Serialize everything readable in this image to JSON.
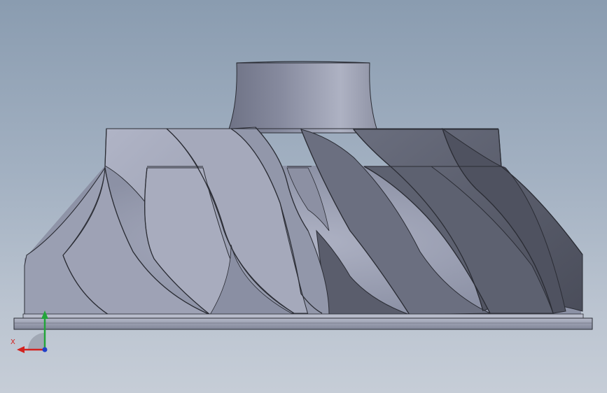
{
  "viewport": {
    "background_top": "#8a9cb0",
    "background_bottom": "#c6cdd7"
  },
  "model": {
    "type": "impeller",
    "blade_count_visible": 14,
    "colors": {
      "light_face": "#a4a9bc",
      "mid_face": "#8d92a6",
      "dark_face": "#5a5e6e",
      "edge": "#2b2d35",
      "base_plate": "#9da2b3"
    }
  },
  "triad": {
    "x_label": "X",
    "x_color": "#d2231f",
    "y_color": "#22a53a",
    "z_color": "#2140c8"
  }
}
